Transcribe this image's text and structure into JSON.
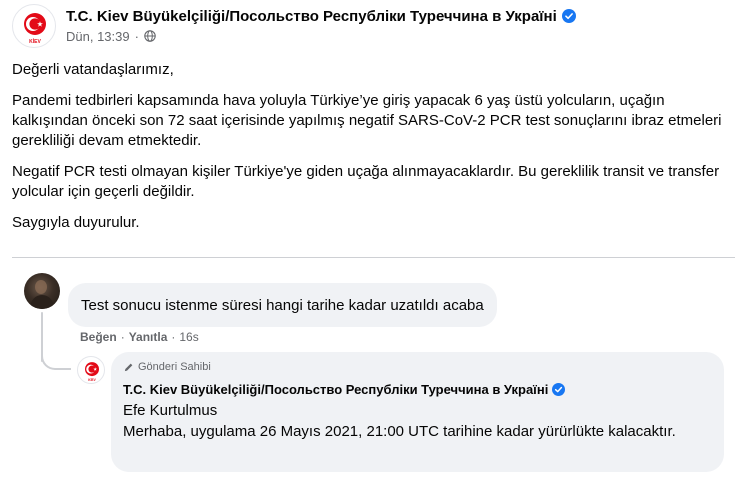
{
  "post": {
    "page_name": "T.C. Kiev Büyükelçiliği/Посольство Республіки Туреччина в Україні",
    "timestamp": "Dün, 13:39",
    "separator": "·",
    "logo_text": "KİEV",
    "paragraphs": [
      "Değerli vatandaşlarımız,",
      "Pandemi tedbirleri kapsamında hava yoluyla Türkiye’ye giriş yapacak 6 yaş üstü yolcuların, uçağın kalkışından önceki son 72 saat içerisinde yapılmış negatif SARS-CoV-2 PCR test sonuçlarını ibraz etmeleri gerekliliği devam etmektedir.",
      "Negatif PCR testi olmayan kişiler Türkiye'ye giden uçağa alınmayacaklardır. Bu gereklilik transit ve transfer yolcular için geçerli değildir.",
      "Saygıyla duyurulur."
    ]
  },
  "comment": {
    "text": "Test sonucu istenme süresi hangi tarihe kadar uzatıldı acaba",
    "like_label": "Beğen",
    "reply_label": "Yanıtla",
    "separator": "·",
    "time": "16s"
  },
  "reply": {
    "badge": "Gönderi Sahibi",
    "page_name": "T.C. Kiev Büyükelçiliği/Посольство Республіки Туреччина в Україні",
    "tagged_name": "Efe Kurtulmus",
    "text": "Merhaba, uygulama 26 Mayıs 2021, 21:00 UTC tarihine kadar yürürlükte kalacaktır."
  },
  "colors": {
    "verified": "#1877f2",
    "secondary_text": "#65676b",
    "bubble": "#f0f2f5",
    "emblem_red": "#e30a17"
  },
  "icons": {
    "verified": "verified-badge-icon",
    "globe": "globe-icon",
    "pen": "pen-icon"
  }
}
